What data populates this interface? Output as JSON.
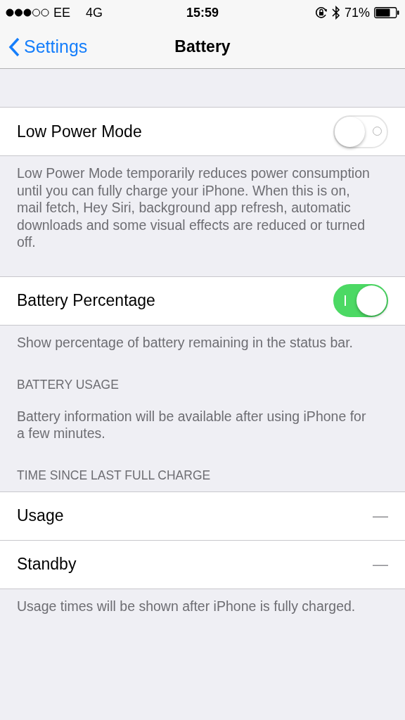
{
  "status_bar": {
    "carrier": "EE",
    "network": "4G",
    "time": "15:59",
    "battery_percent": "71%"
  },
  "nav_bar": {
    "back_label": "Settings",
    "title": "Battery"
  },
  "sections": [
    {
      "rows": [
        {
          "kind": "toggle",
          "label": "Low Power Mode",
          "on": false
        }
      ],
      "footer": "Low Power Mode temporarily reduces power consumption until you can fully charge your iPhone. When this is on, mail fetch, Hey Siri, background app refresh, automatic downloads and some visual effects are reduced or turned off."
    },
    {
      "rows": [
        {
          "kind": "toggle",
          "label": "Battery Percentage",
          "on": true
        }
      ],
      "footer": "Show percentage of battery remaining in the status bar."
    },
    {
      "header": "BATTERY USAGE",
      "footer": "Battery information will be available after using iPhone for a few minutes."
    },
    {
      "header": "TIME SINCE LAST FULL CHARGE",
      "rows": [
        {
          "kind": "value",
          "label": "Usage",
          "value": "—"
        },
        {
          "kind": "value",
          "label": "Standby",
          "value": "—"
        }
      ],
      "footer": "Usage times will be shown after iPhone is fully charged."
    }
  ]
}
